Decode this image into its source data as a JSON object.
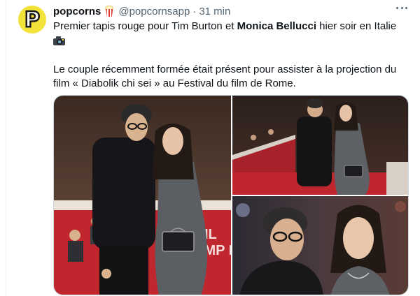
{
  "tweet": {
    "author_name": "popcorns",
    "author_handle": "@popcornsapp",
    "separator": "·",
    "time": "31 min",
    "avatar_letter": "P",
    "avatar_color": "#f2e23a",
    "name_emoji": "popcorn-icon",
    "text": {
      "line1_a": "Premier tapis rouge pour Tim Burton et ",
      "line1_bold": "Monica Bellucci",
      "line1_b": " hier soir en Italie",
      "line1_emoji": "camera-flash-icon",
      "para2": "Le couple récemment formée était présent pour assister à la projection du film « Diabolik chi sei » au Festival du film de Rome."
    },
    "media": [
      {
        "name": "red-carpet-photo-full-length",
        "backdrop_text": "IL\nAMP RO"
      },
      {
        "name": "red-carpet-photo-wide"
      },
      {
        "name": "red-carpet-photo-closeup"
      }
    ]
  },
  "colors": {
    "text": "#0f1419",
    "secondary": "#536471",
    "border": "#cfd9de",
    "carpet_red": "#c0262d"
  }
}
